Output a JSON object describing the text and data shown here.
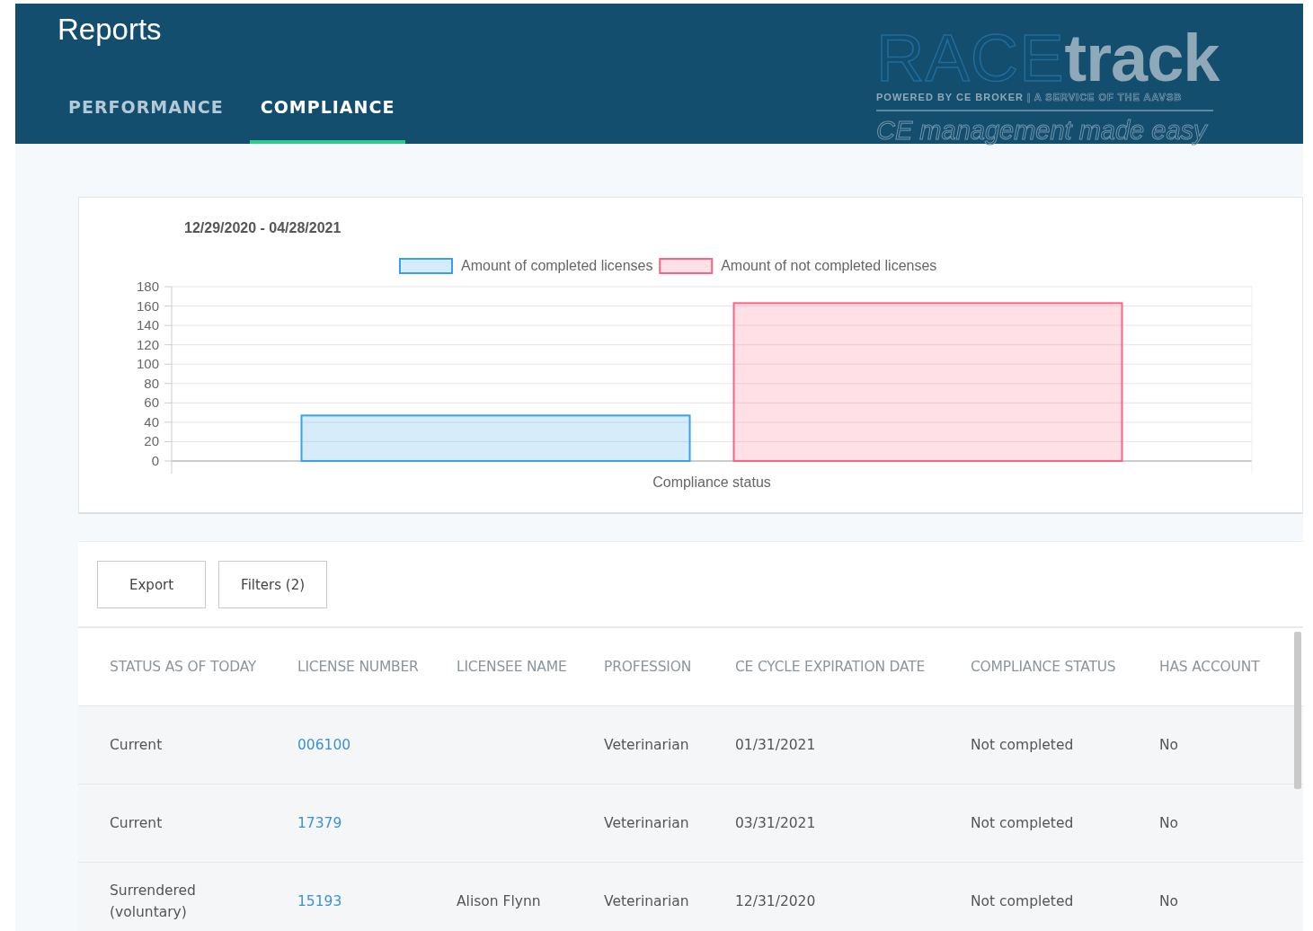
{
  "header": {
    "title": "Reports",
    "tabs": [
      {
        "label": "PERFORMANCE",
        "selected": false
      },
      {
        "label": "COMPLIANCE",
        "selected": true
      }
    ],
    "logo": {
      "outlined": "RACE",
      "solid": "track",
      "byline_bold": "POWERED BY CE BROKER",
      "byline_rest": "| A SERVICE OF THE AAVSB",
      "tagline": "CE management made easy"
    }
  },
  "chart": {
    "date_range": "12/29/2020 - 04/28/2021",
    "chart_data": {
      "type": "bar",
      "grid": true,
      "legend": true,
      "categories": [
        "Compliance status"
      ],
      "ylim": [
        0,
        180
      ],
      "yticks": [
        0,
        20,
        40,
        60,
        80,
        100,
        120,
        140,
        160,
        180
      ],
      "series": [
        {
          "name": "Amount of completed licenses",
          "color": "#36a2eb",
          "values": [
            47
          ]
        },
        {
          "name": "Amount of not completed licenses",
          "color": "#ff6384",
          "values": [
            163
          ]
        }
      ]
    }
  },
  "toolbar": {
    "buttons": [
      "Export",
      "Filters (2)"
    ]
  },
  "table": {
    "columns": [
      "STATUS AS OF TODAY",
      "LICENSE NUMBER",
      "LICENSEE NAME",
      "PROFESSION",
      "CE CYCLE EXPIRATION DATE",
      "COMPLIANCE STATUS",
      "HAS ACCOUNT"
    ],
    "rows": [
      [
        "Current",
        "006100",
        "",
        "Veterinarian",
        "01/31/2021",
        "Not completed",
        "No"
      ],
      [
        "Current",
        "17379",
        "",
        "Veterinarian",
        "03/31/2021",
        "Not completed",
        "No"
      ],
      [
        "Surrendered (voluntary)",
        "15193",
        "Alison Flynn",
        "Veterinarian",
        "12/31/2020",
        "Not completed",
        "No"
      ]
    ]
  }
}
